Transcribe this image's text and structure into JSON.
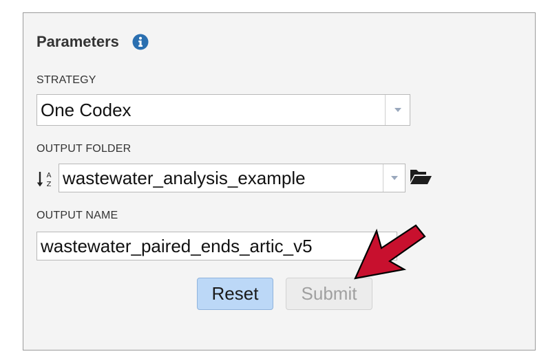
{
  "panel": {
    "title": "Parameters",
    "info_icon": "info-circle-icon"
  },
  "strategy": {
    "label": "STRATEGY",
    "value": "One Codex"
  },
  "output_folder": {
    "label": "OUTPUT FOLDER",
    "value": "wastewater_analysis_example",
    "sort_icon": "sort-alpha-icon",
    "browse_icon": "folder-open-icon"
  },
  "output_name": {
    "label": "OUTPUT NAME",
    "value": "wastewater_paired_ends_artic_v5"
  },
  "buttons": {
    "reset": "Reset",
    "submit": "Submit"
  },
  "annotation": {
    "icon": "red-arrow-icon",
    "color": "#c8102e"
  },
  "colors": {
    "info_icon": "#2a6fb0",
    "reset_bg": "#bcd8f7",
    "submit_disabled_text": "#a0a0a0"
  }
}
